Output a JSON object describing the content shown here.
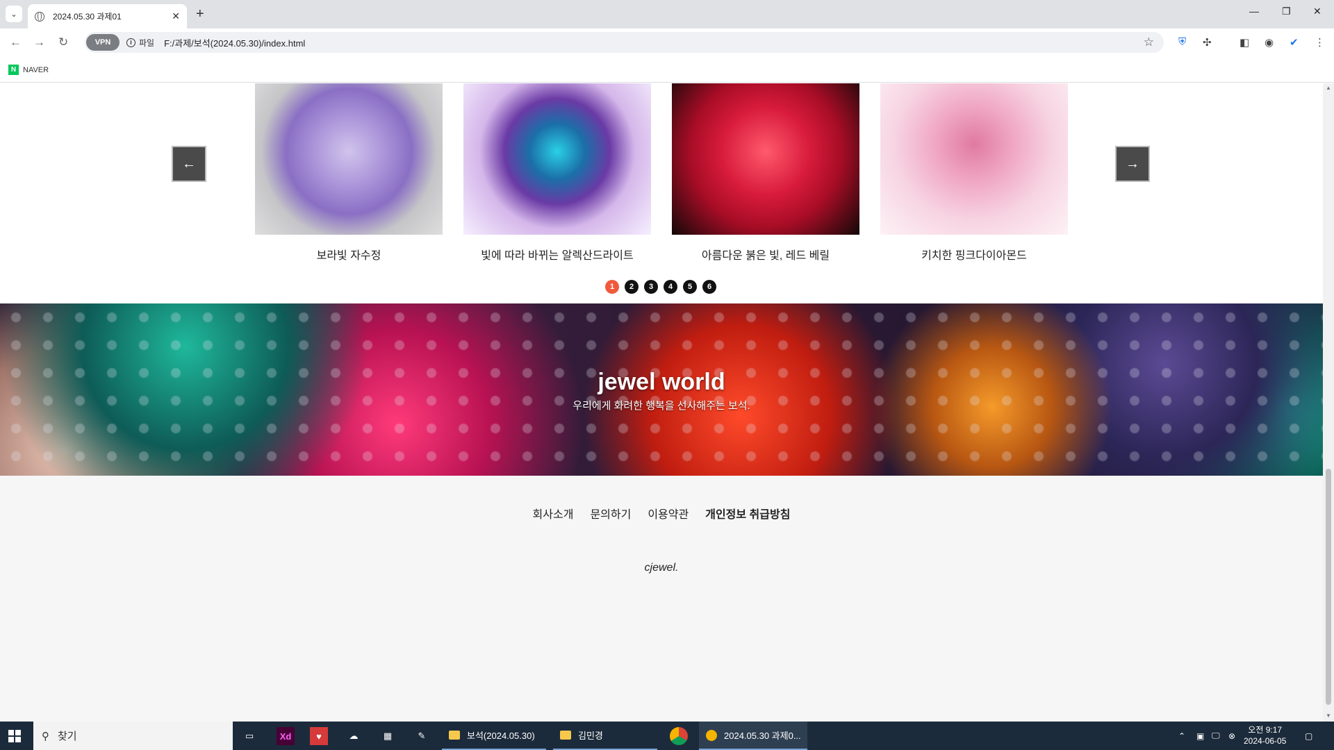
{
  "browser": {
    "tab_title": "2024.05.30 과제01",
    "tab_close": "✕",
    "new_tab": "+",
    "tab_menu": "⌄",
    "vpn_label": "VPN",
    "info_label": "파일",
    "url": "F:/과제/보석(2024.05.30)/index.html",
    "bookmark_naver": "NAVER",
    "window_minimize": "—",
    "window_restore": "❐",
    "window_close": "✕"
  },
  "slider": {
    "prev_label": "←",
    "next_label": "→",
    "items": [
      {
        "caption": "보라빛 자수정",
        "image": "purple heart amethyst"
      },
      {
        "caption": "빛에 따라 바뀌는 알렉산드라이트",
        "image": "blue-violet round alexandrite"
      },
      {
        "caption": "아름다운 붉은 빛, 레드 베릴",
        "image": "red beryl"
      },
      {
        "caption": "키치한 핑크다이아몬드",
        "image": "pink oval diamond"
      }
    ],
    "pages": [
      "1",
      "2",
      "3",
      "4",
      "5",
      "6"
    ],
    "active_page": "1"
  },
  "banner": {
    "title": "jewel world",
    "subtitle": "우리에게 화려한 행복을 선사해주는 보석."
  },
  "footer": {
    "links": [
      "회사소개",
      "문의하기",
      "이용약관",
      "개인정보 취급방침"
    ],
    "copyright": "cjewel."
  },
  "taskbar": {
    "search_placeholder": "찾기",
    "apps": [
      {
        "label": "보석(2024.05.30)",
        "icon": "folder-icon"
      },
      {
        "label": "김민경",
        "icon": "folder-icon"
      },
      {
        "label": "2024.05.30 과제0...",
        "icon": "browser-icon"
      }
    ],
    "xd_label": "Xd",
    "time": "오전 9:17",
    "date": "2024-06-05"
  },
  "colors": {
    "active_dot": "#f05a3c",
    "dot": "#111111",
    "arrow_button": "#4a4a4a",
    "taskbar": "#1c2b3b"
  }
}
